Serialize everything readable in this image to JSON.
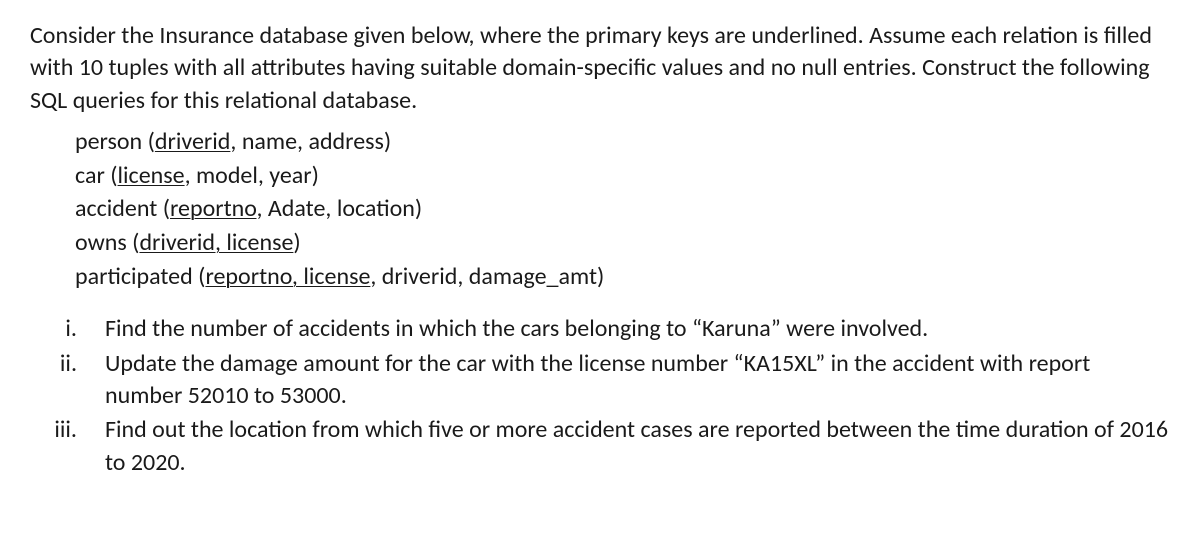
{
  "intro": "Consider the Insurance database given below, where the primary keys are underlined. Assume each relation is filled with 10 tuples with all attributes having suitable domain-specific values and no null entries. Construct the following SQL queries for this relational database.",
  "schema": {
    "person": {
      "name": "person",
      "pk": "driverid",
      "rest": ", name, address)"
    },
    "car": {
      "name": "car",
      "pk": "license",
      "rest": ", model, year)"
    },
    "accident": {
      "name": "accident",
      "pk": "reportno",
      "rest": ", Adate, location)"
    },
    "owns": {
      "name": "owns",
      "pk": "driverid, license",
      "rest": ")"
    },
    "participated": {
      "name": "participated",
      "pk": "reportno, license",
      "rest": ", driverid, damage_amt)"
    }
  },
  "questions": {
    "q1": {
      "num": "i.",
      "text": "Find the number of accidents in which the cars belonging to “Karuna” were involved."
    },
    "q2": {
      "num": "ii.",
      "text": "Update the damage amount for the car with the license number “KA15XL” in the accident with report number 52010 to 53000."
    },
    "q3": {
      "num": "iii.",
      "text": "Find out the location from which five or more accident cases are reported between the time duration of 2016 to 2020."
    }
  }
}
